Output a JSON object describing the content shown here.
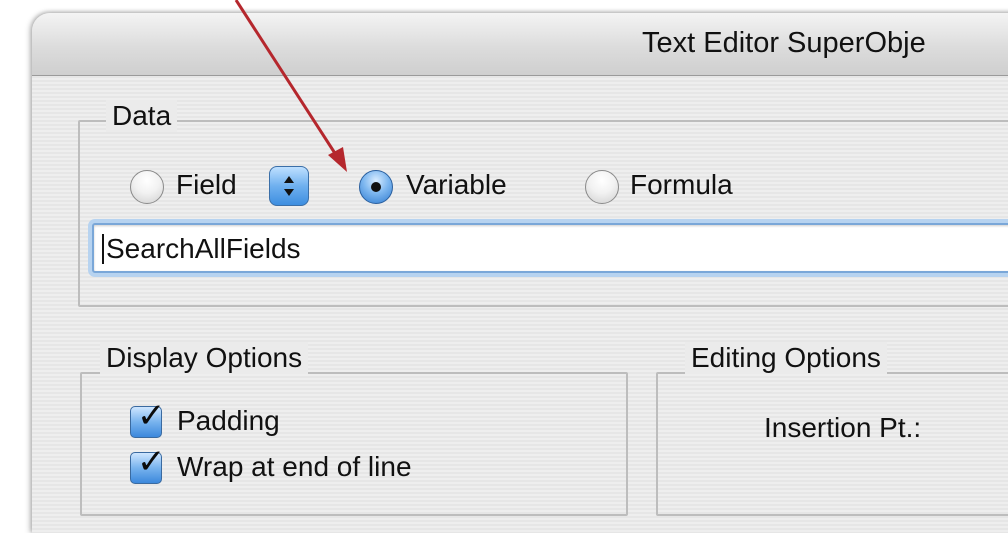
{
  "window": {
    "title": "Text Editor SuperObje"
  },
  "data_group": {
    "label": "Data",
    "radios": [
      {
        "label": "Field",
        "selected": false
      },
      {
        "label": "Variable",
        "selected": true
      },
      {
        "label": "Formula",
        "selected": false
      }
    ],
    "field_stepper_icon": "stepper-icon",
    "text_value": "SearchAllFields"
  },
  "display_options": {
    "label": "Display Options",
    "checkboxes": [
      {
        "label": "Padding",
        "checked": true
      },
      {
        "label": "Wrap at end of line",
        "checked": true
      }
    ]
  },
  "editing_options": {
    "label": "Editing Options",
    "insertion_label": "Insertion Pt.:"
  },
  "annotation": {
    "arrow_color": "#b5272d"
  },
  "colors": {
    "accent": "#3d8ee0"
  }
}
